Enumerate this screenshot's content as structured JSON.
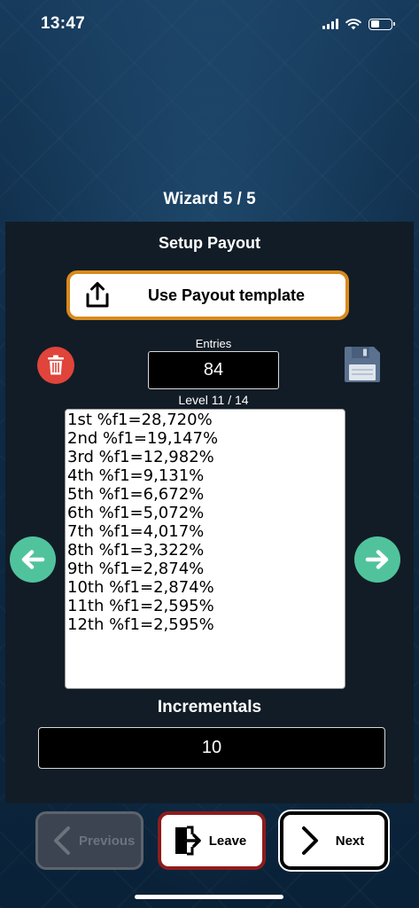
{
  "status_bar": {
    "time": "13:47"
  },
  "wizard": {
    "title": "Wizard 5 / 5"
  },
  "payout": {
    "section_title": "Setup Payout",
    "template_button_label": "Use Payout template",
    "entries_label": "Entries",
    "entries_value": "84",
    "level_label": "Level 11 / 14",
    "lines": [
      "1st %f1=28,720%",
      "2nd %f1=19,147%",
      "3rd %f1=12,982%",
      "4th %f1=9,131%",
      "5th %f1=6,672%",
      "6th %f1=5,072%",
      "7th %f1=4,017%",
      "8th %f1=3,322%",
      "9th %f1=2,874%",
      "10th %f1=2,874%",
      "11th %f1=2,595%",
      "12th %f1=2,595%"
    ]
  },
  "incrementals": {
    "title": "Incrementals",
    "value": "10"
  },
  "footer": {
    "previous_label": "Previous",
    "leave_label": "Leave",
    "next_label": "Next"
  },
  "colors": {
    "template_border": "#d98a1d",
    "trash": "#e0443a",
    "arrows": "#50c39d",
    "leave_border": "#8e1c1c",
    "save_icon": "#5b7190"
  },
  "icons": {
    "template": "share-upload-icon",
    "delete": "trash-icon",
    "save": "floppy-disk-icon",
    "prev_level": "arrow-left-icon",
    "next_level": "arrow-right-icon",
    "previous": "chevron-left-icon",
    "leave": "exit-door-icon",
    "next": "chevron-right-icon"
  }
}
